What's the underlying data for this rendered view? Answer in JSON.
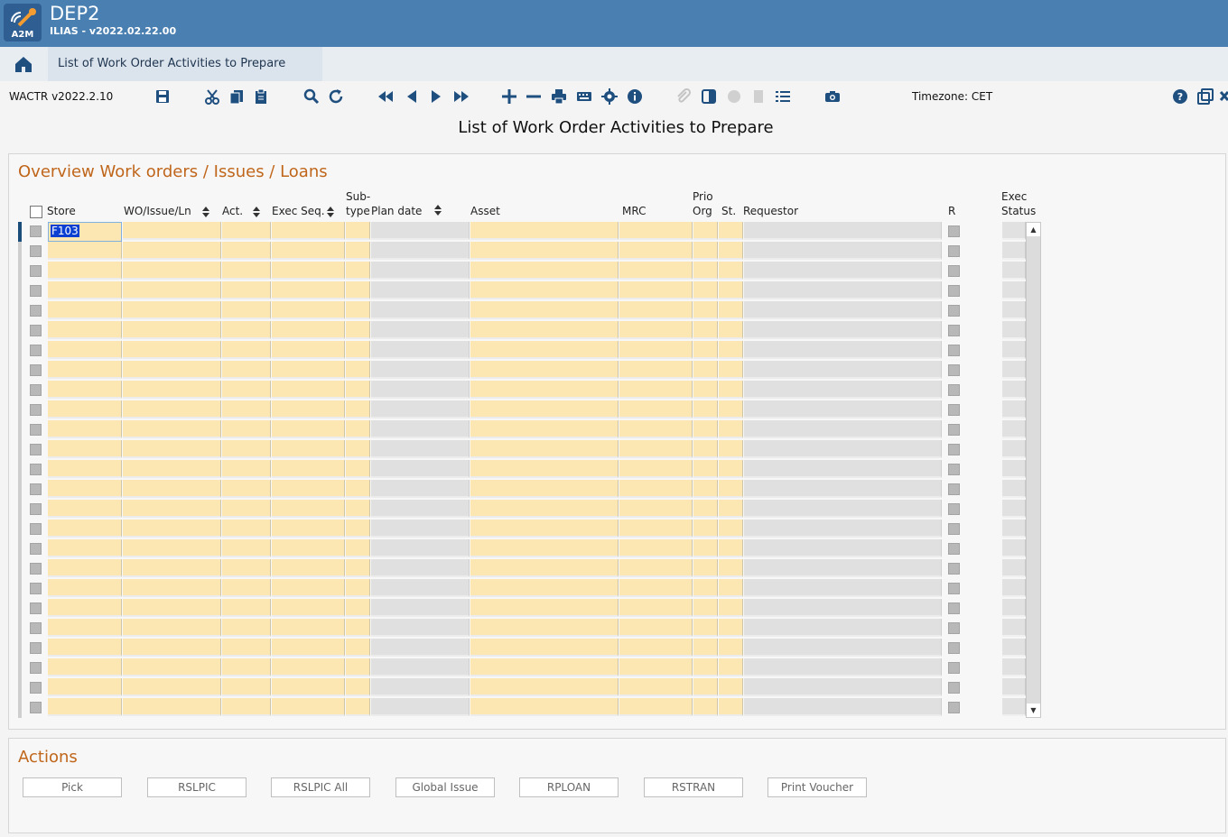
{
  "app": {
    "title": "DEP2",
    "version": "ILIAS - v2022.02.22.00",
    "logo_text": "A2M"
  },
  "tab": {
    "label": "List of Work Order Activities to Prepare"
  },
  "toolbar": {
    "module_code": "WACTR v2022.2.10",
    "timezone": "Timezone: CET"
  },
  "page": {
    "heading": "List of Work Order Activities to Prepare"
  },
  "overview": {
    "title": "Overview Work orders / Issues / Loans",
    "headers": {
      "store": "Store",
      "wo_issue_ln": "WO/Issue/Ln",
      "act": "Act.",
      "exec_seq": "Exec Seq.",
      "subtype_1": "Sub-",
      "subtype_2": "type",
      "plan_date": "Plan date",
      "asset": "Asset",
      "mrc": "MRC",
      "prio_org_1": "Prio",
      "prio_org_2": "Org",
      "st": "St.",
      "requestor": "Requestor",
      "r": "R",
      "exec_status_1": "Exec",
      "exec_status_2": "Status"
    },
    "first_row_store": "F103",
    "row_count": 25
  },
  "actions": {
    "title": "Actions",
    "buttons": [
      "Pick",
      "RSLPIC",
      "RSLPIC All",
      "Global Issue",
      "RPLOAN",
      "RSTRAN",
      "Print Voucher"
    ]
  },
  "colors": {
    "header_blue": "#4a7fb1",
    "accent_orange": "#c0661b",
    "editable_cell": "#fce6b1",
    "readonly_cell": "#e0e0e0",
    "icon_blue": "#1f4f7f"
  }
}
